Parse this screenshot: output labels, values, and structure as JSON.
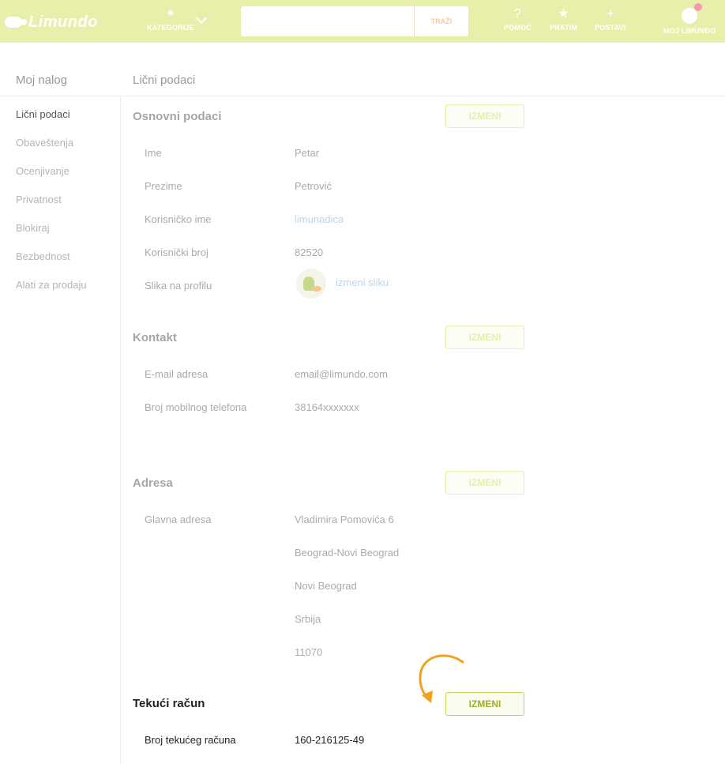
{
  "header": {
    "logo": "Limundo",
    "kategorije": "KATEGORIJE",
    "search_placeholder": "",
    "search_button": "TRAŽI",
    "pomoc": "POMOĆ",
    "pratim": "PRATIM",
    "postavi": "POSTAVI",
    "moj_limundo": "MOJ LIMUNDO",
    "brand_color": "#e8efab",
    "notification_color": "#f29ab0"
  },
  "sidebar": {
    "title": "Moj nalog",
    "items": [
      {
        "label": "Lični podaci"
      },
      {
        "label": "Obaveštenja"
      },
      {
        "label": "Ocenjivanje"
      },
      {
        "label": "Privatnost"
      },
      {
        "label": "Blokiraj"
      },
      {
        "label": "Bezbednost"
      },
      {
        "label": "Alati za prodaju"
      }
    ]
  },
  "main": {
    "title": "Lični podaci",
    "edit_label": "IZMENI",
    "osnovni": {
      "title": "Osnovni podaci",
      "ime_label": "Ime",
      "ime": "Petar",
      "prezime_label": "Prezime",
      "prezime": "Petrović",
      "korisnicko_ime_label": "Korisničko ime",
      "korisnicko_ime": "limunadica",
      "korisnicki_broj_label": "Korisnički broj",
      "korisnicki_broj": "82520",
      "slika_label": "Slika na profilu",
      "slika_link": "izmeni sliku"
    },
    "kontakt": {
      "title": "Kontakt",
      "email_label": "E-mail adresa",
      "email": "email@limundo.com",
      "telefon_label": "Broj mobilnog telefona",
      "telefon": "38164xxxxxxx"
    },
    "adresa": {
      "title": "Adresa",
      "glavna_label": "Glavna adresa",
      "lines": [
        "Vladimira Pomovića 6",
        "Beograd-Novi Beograd",
        "Novi Beograd",
        "Srbija",
        "11070"
      ]
    },
    "racun": {
      "title": "Tekući račun",
      "broj_label": "Broj tekućeg računa",
      "broj": "160-216125-49"
    }
  }
}
